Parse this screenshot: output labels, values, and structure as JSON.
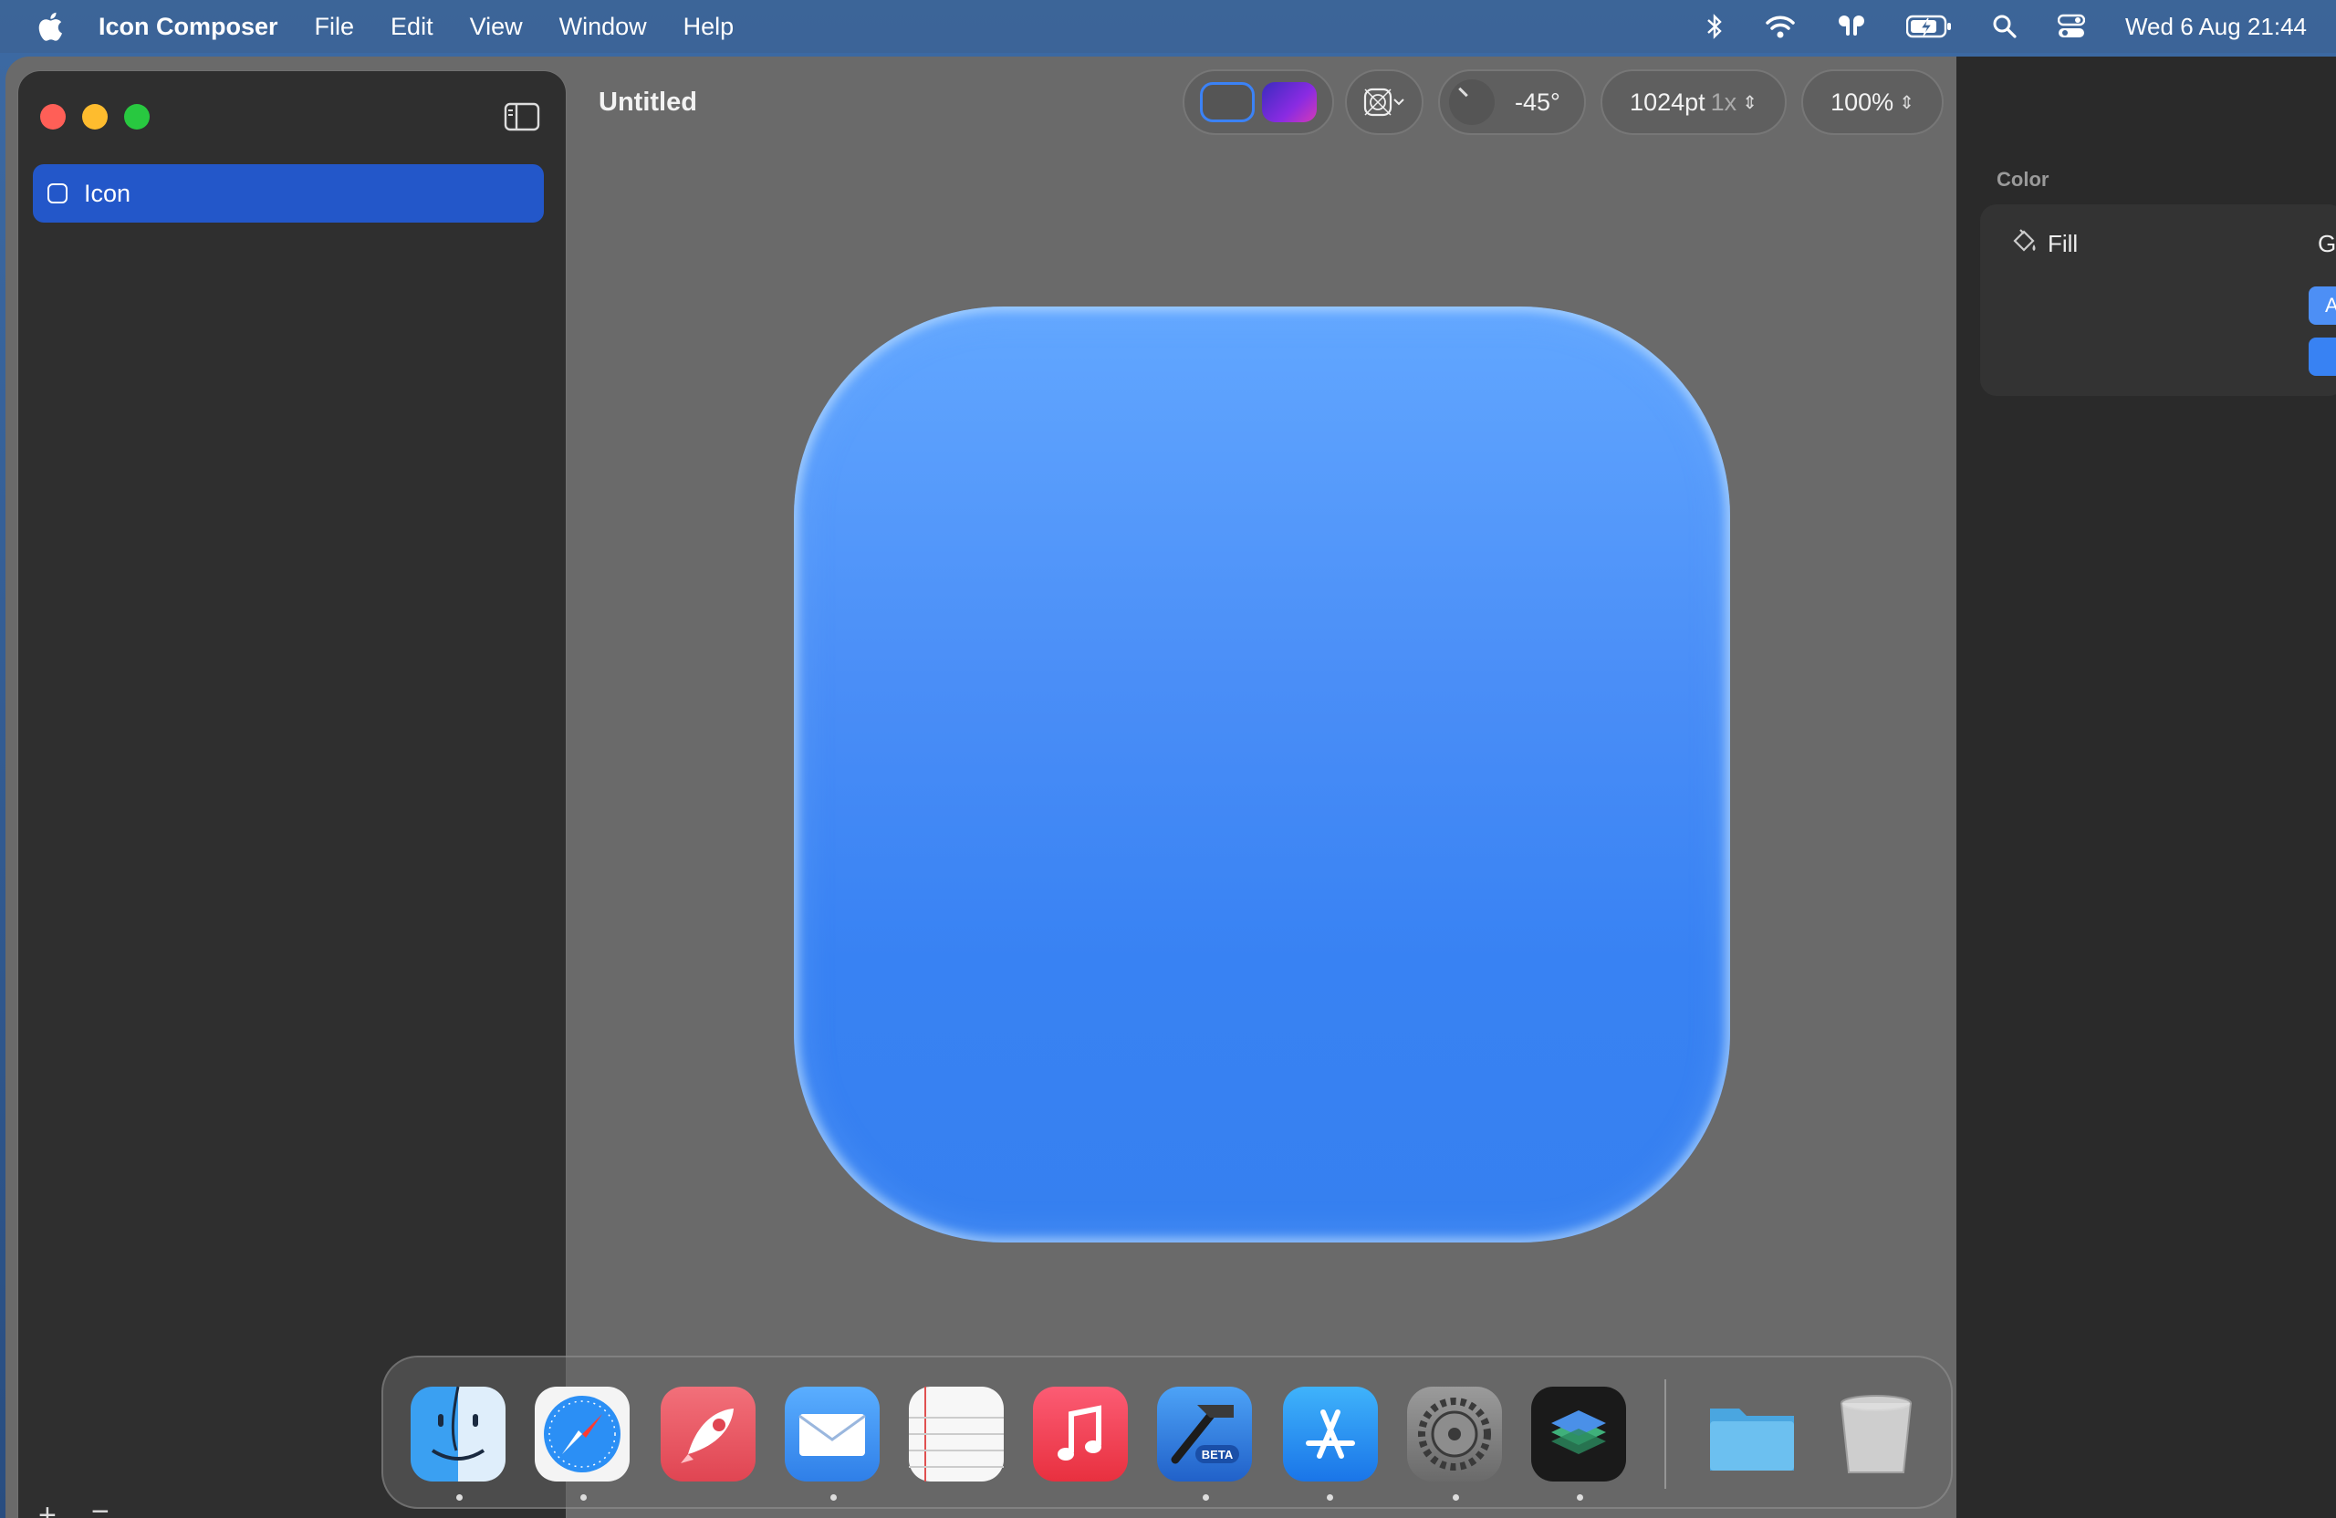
{
  "menubar": {
    "app_name": "Icon Composer",
    "items": [
      "File",
      "Edit",
      "View",
      "Window",
      "Help"
    ],
    "clock": "Wed 6 Aug  21:44"
  },
  "window": {
    "title": "Untitled"
  },
  "sidebar": {
    "layers": [
      {
        "label": "Icon",
        "selected": true
      }
    ],
    "add_label": "+",
    "remove_label": "−"
  },
  "toolbar": {
    "light_dark_dark_gradient": [
      "#3b2bbf",
      "#8a2be2",
      "#d43ab7"
    ],
    "angle": "-45°",
    "size": "1024pt",
    "scale": "1x",
    "zoom": "100%"
  },
  "canvas": {
    "icon_gradient_top": "#62a7ff",
    "icon_gradient_bottom": "#3680f0"
  },
  "inspector": {
    "section_heading": "Color",
    "fill_label": "Fill",
    "fill_type": "Gr",
    "auto_label": "Au",
    "fill_color": "#3882f3"
  },
  "dock": {
    "apps": [
      "finder-icon",
      "safari-icon",
      "launchpad-icon",
      "mail-icon",
      "textedit-icon",
      "music-icon",
      "xcode-beta-icon",
      "app-store-icon",
      "system-settings-icon",
      "icon-composer-icon"
    ],
    "others": [
      "folder-icon",
      "trash-icon"
    ],
    "xcode_badge": "BETA"
  }
}
